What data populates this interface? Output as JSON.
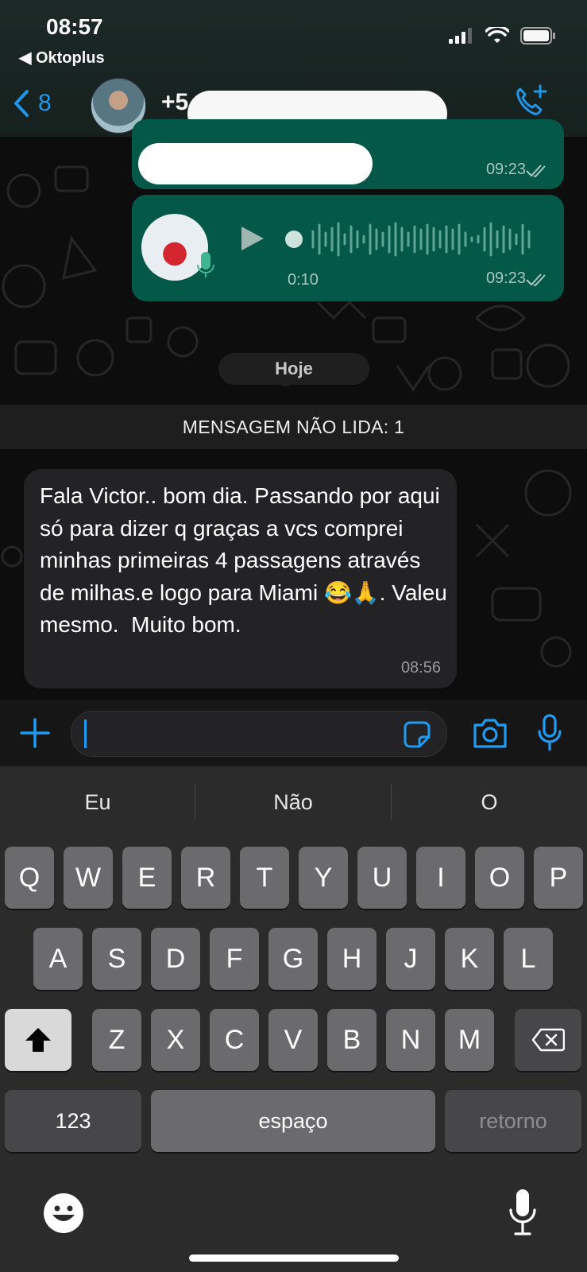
{
  "status_bar": {
    "time": "08:57",
    "carrier": "◀ Oktoplus"
  },
  "header": {
    "back_count": "8",
    "contact_prefix": "+5"
  },
  "messages_out": [
    {
      "time": "09:23"
    },
    {
      "duration": "0:10",
      "time": "09:23"
    }
  ],
  "date_separator": "Hoje",
  "unread_banner": "MENSAGEM NÃO LIDA: 1",
  "message_in": {
    "text": "Fala Victor.. bom dia. Passando por aqui só para dizer q graças a vcs comprei minhas primeiras 4 passagens através de milhas.e logo para Miami 😂🙏. Valeu mesmo.  Muito bom.",
    "time": "08:56"
  },
  "keyboard": {
    "suggestions": [
      "Eu",
      "Não",
      "O"
    ],
    "row1": [
      "Q",
      "W",
      "E",
      "R",
      "T",
      "Y",
      "U",
      "I",
      "O",
      "P"
    ],
    "row2": [
      "A",
      "S",
      "D",
      "F",
      "G",
      "H",
      "J",
      "K",
      "L"
    ],
    "row3": [
      "Z",
      "X",
      "C",
      "V",
      "B",
      "N",
      "M"
    ],
    "numbers_key": "123",
    "space_key": "espaço",
    "return_key": "retorno"
  },
  "colors": {
    "accent": "#1f9cf2",
    "bubble_out": "#045847",
    "bubble_in": "#232325"
  }
}
